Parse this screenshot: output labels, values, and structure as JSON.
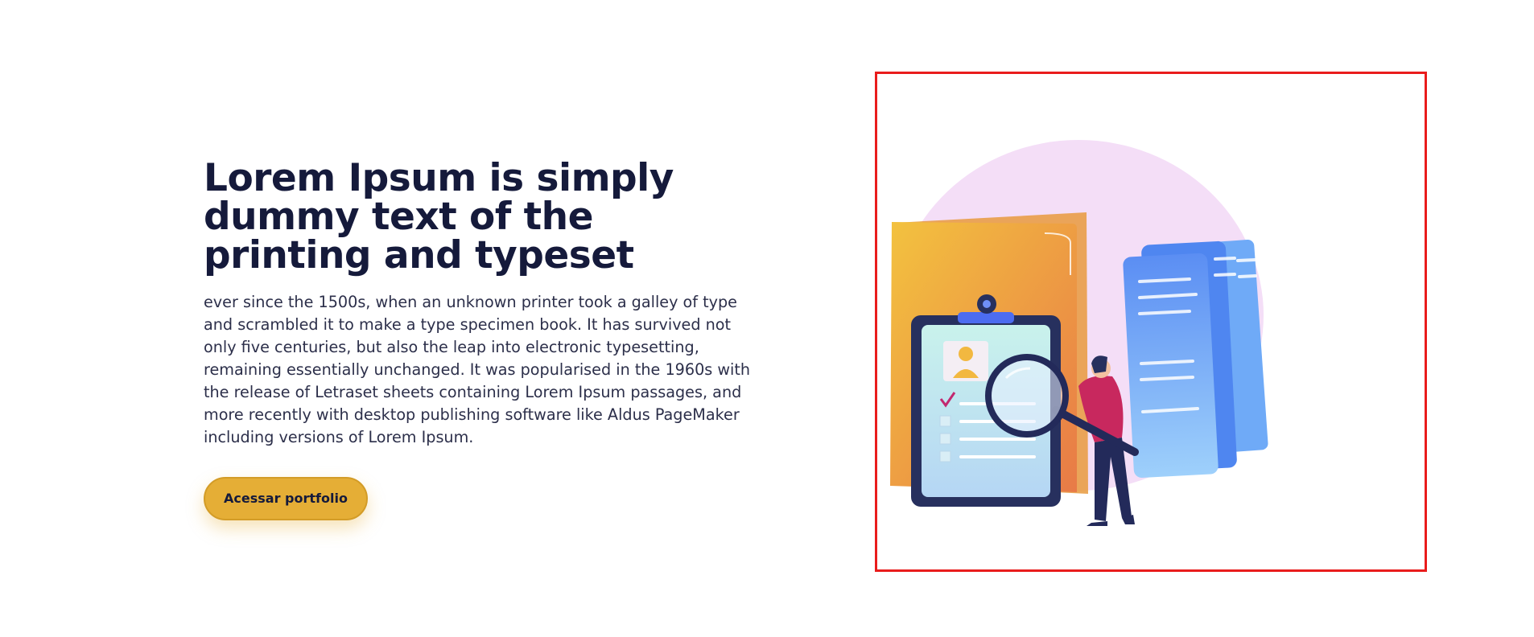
{
  "hero": {
    "title": "Lorem Ipsum is simply dummy text of the printing and typeset",
    "body": "ever since the 1500s, when an unknown printer took a galley of type and scrambled it to make a type specimen book. It has survived not only five centuries, but also the leap into electronic typesetting, remaining essentially unchanged. It was popularised in the 1960s with the release of Letraset sheets containing Lorem Ipsum passages, and more recently with desktop publishing software like Aldus PageMaker including versions of Lorem Ipsum.",
    "cta_label": "Acessar portfolio"
  },
  "illustration": {
    "icon": "document-search-illustration",
    "colors": {
      "frame_border": "#e91c1c",
      "blob": "#f3dcf7",
      "folder": "#f0a640",
      "documents": "#6fa8f5",
      "clipboard": "#27305e",
      "person_shirt": "#c8285e",
      "accent": "#e5ae36"
    }
  },
  "colors": {
    "title": "#151a3b",
    "body": "#2c2f4a",
    "button": "#e5ae36"
  }
}
